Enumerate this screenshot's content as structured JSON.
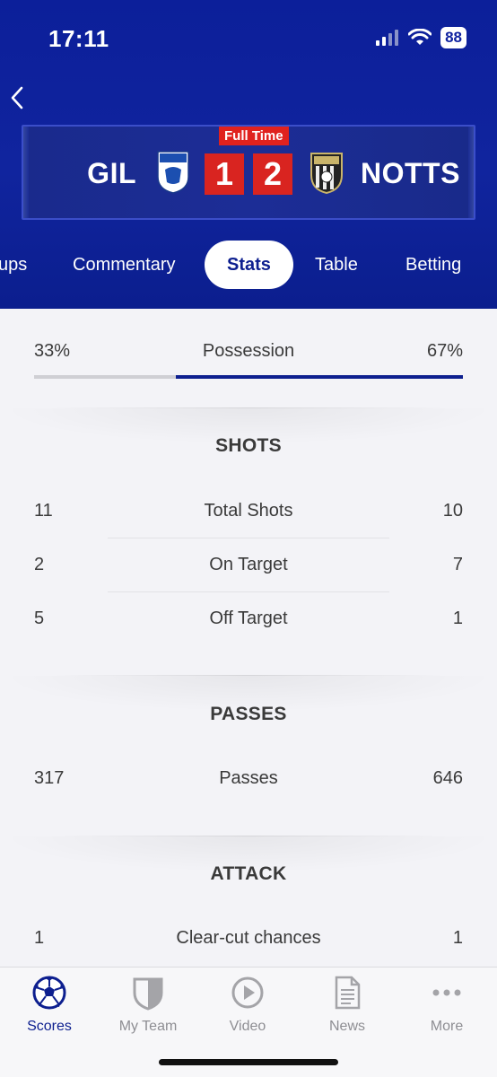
{
  "status_bar": {
    "time": "17:11",
    "battery": "88"
  },
  "match": {
    "status": "Full Time",
    "home_team": "GIL",
    "away_team": "NOTTS",
    "home_score": "1",
    "away_score": "2"
  },
  "tabs": [
    {
      "label": "ups"
    },
    {
      "label": "Commentary"
    },
    {
      "label": "Stats",
      "active": true
    },
    {
      "label": "Table"
    },
    {
      "label": "Betting"
    }
  ],
  "possession": {
    "label": "Possession",
    "home": "33%",
    "away": "67%",
    "home_fraction": 0.33,
    "away_fraction": 0.67
  },
  "sections": {
    "shots": {
      "title": "SHOTS",
      "rows": [
        {
          "label": "Total Shots",
          "home": "11",
          "away": "10"
        },
        {
          "label": "On Target",
          "home": "2",
          "away": "7"
        },
        {
          "label": "Off Target",
          "home": "5",
          "away": "1"
        }
      ]
    },
    "passes": {
      "title": "PASSES",
      "rows": [
        {
          "label": "Passes",
          "home": "317",
          "away": "646"
        }
      ]
    },
    "attack": {
      "title": "ATTACK",
      "rows": [
        {
          "label": "Clear-cut chances",
          "home": "1",
          "away": "1"
        }
      ]
    }
  },
  "bottom_nav": [
    {
      "label": "Scores",
      "icon": "football-icon",
      "active": true
    },
    {
      "label": "My Team",
      "icon": "shield-icon"
    },
    {
      "label": "Video",
      "icon": "play-icon"
    },
    {
      "label": "News",
      "icon": "document-icon"
    },
    {
      "label": "More",
      "icon": "more-icon"
    }
  ],
  "colors": {
    "header": "#10249e",
    "accent": "#0d1f8f",
    "score_red": "#d92420"
  }
}
